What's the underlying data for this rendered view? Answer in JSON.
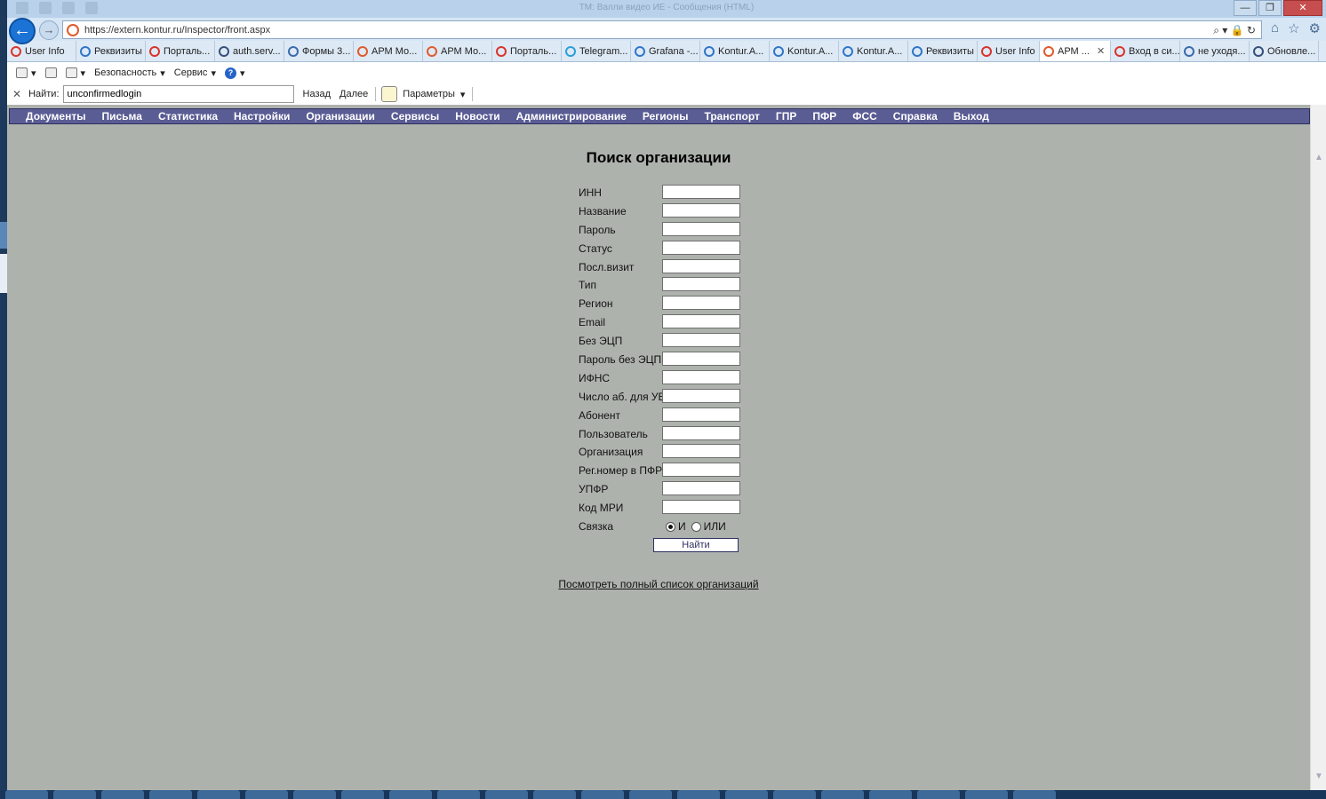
{
  "browser": {
    "window_title": "TM: Валли видео ИЕ - Сообщения (HTML)",
    "window_buttons": {
      "minimize": "—",
      "restore": "❐",
      "close": "✕"
    },
    "address_url": "https://extern.kontur.ru/Inspector/front.aspx",
    "back_glyph": "←",
    "forward_glyph": "→",
    "address_tools": "⌕ ▾ 🔒 ↻",
    "nav_icons": [
      "⌂",
      "☆",
      "⚙"
    ]
  },
  "tabs": [
    {
      "label": "User Info",
      "color": "#d9342b"
    },
    {
      "label": "Реквизиты",
      "color": "#2f76c9"
    },
    {
      "label": "Порталь...",
      "color": "#d9342b"
    },
    {
      "label": "auth.serv...",
      "color": "#35507a"
    },
    {
      "label": "Формы 3...",
      "color": "#3b6aad"
    },
    {
      "label": "АРМ Мо...",
      "color": "#e05a2b"
    },
    {
      "label": "АРМ Мо...",
      "color": "#e05a2b"
    },
    {
      "label": "Порталь...",
      "color": "#d9342b"
    },
    {
      "label": "Telegram...",
      "color": "#2a9fd8"
    },
    {
      "label": "Grafana -...",
      "color": "#2f76c9"
    },
    {
      "label": "Kontur.A...",
      "color": "#2f76c9"
    },
    {
      "label": "Kontur.A...",
      "color": "#2f76c9"
    },
    {
      "label": "Kontur.A...",
      "color": "#2f76c9"
    },
    {
      "label": "Реквизиты",
      "color": "#2f76c9"
    },
    {
      "label": "User Info",
      "color": "#d9342b"
    },
    {
      "label": "АРМ ...",
      "color": "#e05a2b",
      "active": true
    },
    {
      "label": "Вход в си...",
      "color": "#d9342b"
    },
    {
      "label": "не уходя...",
      "color": "#3b6aad"
    },
    {
      "label": "Обновле...",
      "color": "#35507a"
    }
  ],
  "tab_close_glyph": "✕",
  "command_bar": {
    "dropdown_glyph": "▾",
    "safety_label": "Безопасность",
    "service_label": "Сервис",
    "help_glyph": "?"
  },
  "find_bar": {
    "close_glyph": "✕",
    "label": "Найти:",
    "value": "unconfirmedlogin",
    "prev_label": "Назад",
    "next_label": "Далее",
    "params_label": "Параметры"
  },
  "menu": [
    "Документы",
    "Письма",
    "Статистика",
    "Настройки",
    "Организации",
    "Сервисы",
    "Новости",
    "Администрирование",
    "Регионы",
    "Транспорт",
    "ГПР",
    "ПФР",
    "ФСС",
    "Справка",
    "Выход"
  ],
  "form": {
    "title": "Поиск организации",
    "fields": [
      "ИНН",
      "Название",
      "Пароль",
      "Статус",
      "Посл.визит",
      "Тип",
      "Регион",
      "Email",
      "Без ЭЦП",
      "Пароль без ЭЦП",
      "ИФНС",
      "Число аб. для УБ",
      "Абонент",
      "Пользователь",
      "Организация",
      "Рег.номер в ПФР",
      "УПФР",
      "Код МРИ"
    ],
    "link_label": "Связка",
    "radio_and": "И",
    "radio_or": "ИЛИ",
    "submit": "Найти",
    "full_list_link": "Посмотреть полный список организаций"
  },
  "scroll": {
    "up_glyph": "▲",
    "down_glyph": "▼"
  },
  "colors": {
    "page_bg": "#aeb2ad",
    "menu_bg": "#5a5c94",
    "browser_chrome": "#d6e6f5"
  }
}
